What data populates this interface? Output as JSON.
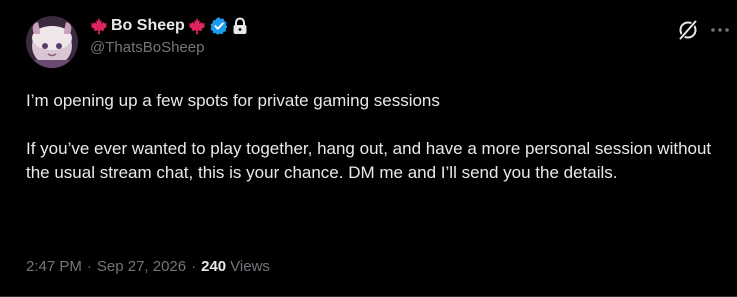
{
  "author": {
    "display_name": "Bo Sheep",
    "handle": "@ThatsBoSheep",
    "verified": true,
    "protected": true,
    "flag_icon": "maple-leaf-icon",
    "flag_color": "#e0245e",
    "verified_color": "#1d9bf0"
  },
  "toolbar": {
    "grok_icon": "grok-icon",
    "more_icon": "more-horizontal-icon"
  },
  "post": {
    "paragraphs": [
      "I’m opening up a few spots for private gaming sessions",
      "If you’ve ever wanted to play together, hang out, and have a more personal session without the usual stream chat, this is your chance. DM me and I’ll send you the details."
    ]
  },
  "meta": {
    "time": "2:47 PM",
    "separator": "·",
    "date": "Sep 27, 2026",
    "views_count": "240",
    "views_label": "Views"
  },
  "colors": {
    "background": "#000000",
    "text": "#e7e9ea",
    "muted": "#71767b"
  }
}
